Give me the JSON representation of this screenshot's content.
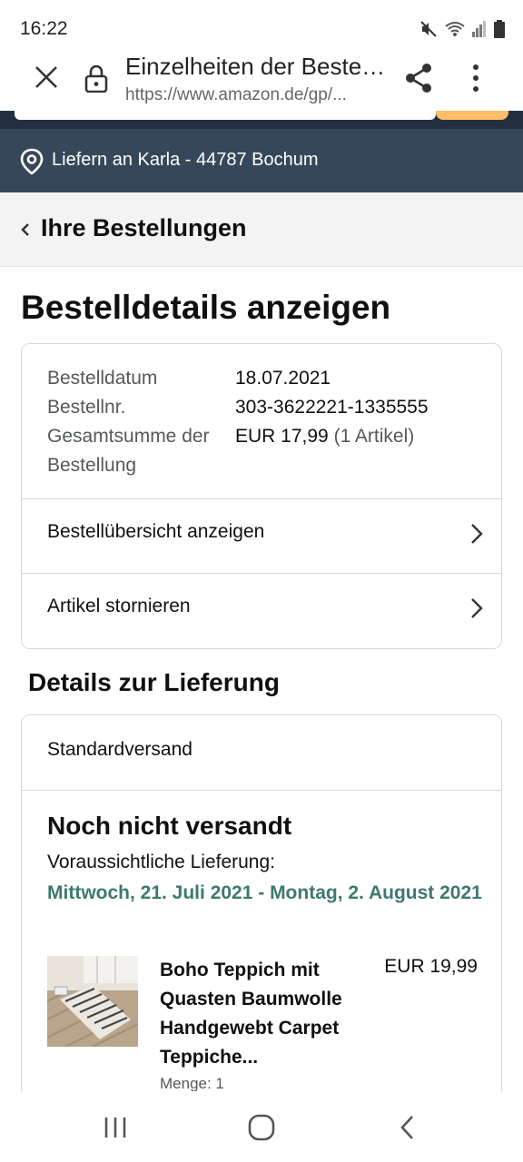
{
  "status_bar": {
    "time": "16:22"
  },
  "browser_tab": {
    "title": "Einzelheiten der Bestellung",
    "url": "https://www.amazon.de/gp/..."
  },
  "delivery_bar": {
    "text": "Liefern an Karla - 44787 Bochum"
  },
  "breadcrumb": {
    "label": "Ihre Bestellungen"
  },
  "page": {
    "title": "Bestelldetails anzeigen"
  },
  "order": {
    "rows": [
      {
        "label": "Bestelldatum",
        "value": "18.07.2021"
      },
      {
        "label": "Bestellnr.",
        "value": "303-3622221-1335555"
      },
      {
        "label": "Gesamtsumme der Bestellung",
        "value": "EUR 17,99",
        "value_suffix": "(1 Artikel)"
      }
    ],
    "links": [
      {
        "label": "Bestellübersicht anzeigen"
      },
      {
        "label": "Artikel stornieren"
      }
    ]
  },
  "delivery": {
    "section_title": "Details zur Lieferung",
    "method": "Standardversand",
    "status": "Noch nicht versandt",
    "expected_label": "Voraussichtliche Lieferung:",
    "expected_date": "Mittwoch, 21. Juli 2021 - Montag, 2. August 2021",
    "date_color": "#3d7a6c"
  },
  "product": {
    "title": "Boho Teppich mit Quasten Baumwolle Handgewebt Carpet Teppiche...",
    "price": "EUR 19,99",
    "quantity": "Menge: 1"
  },
  "colors": {
    "header_dark": "#232f3e",
    "delivery_bar": "#37475a",
    "search_button": "#febd69"
  }
}
